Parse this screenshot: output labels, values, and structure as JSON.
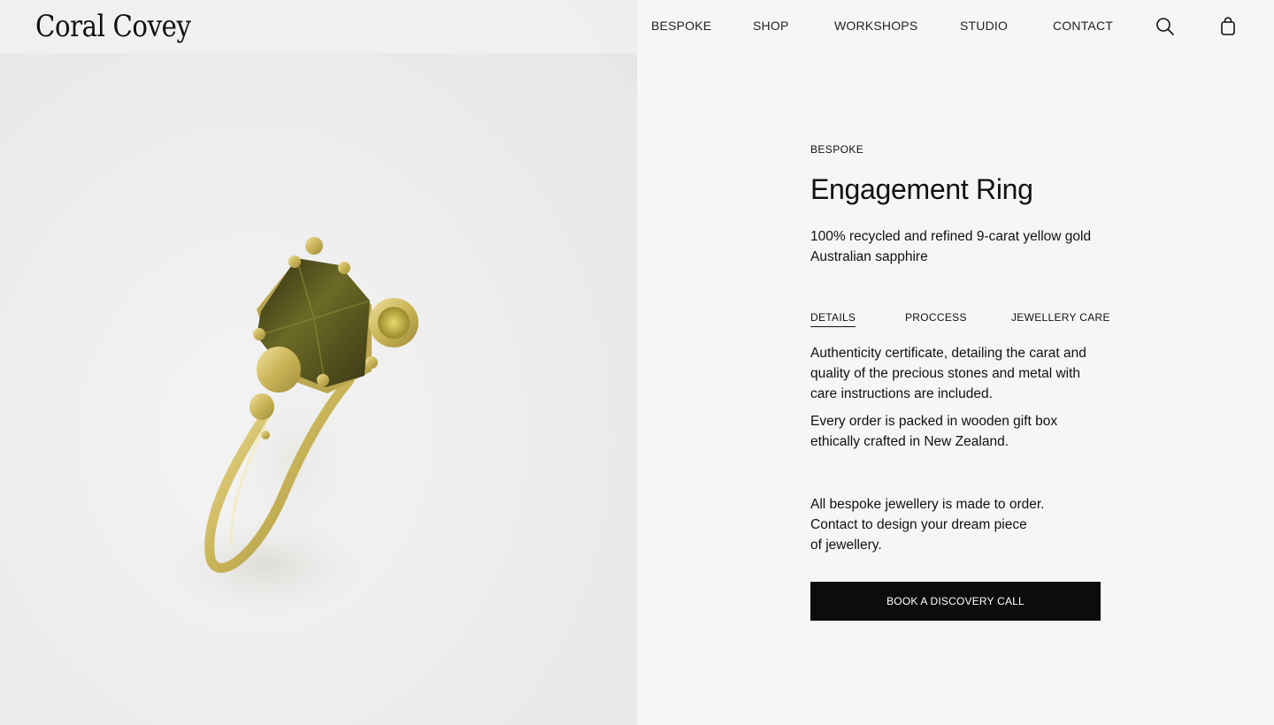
{
  "brand": {
    "logo_text": "Coral Covey"
  },
  "nav": {
    "items": [
      {
        "label": "BESPOKE"
      },
      {
        "label": "SHOP"
      },
      {
        "label": "WORKSHOPS"
      },
      {
        "label": "STUDIO"
      },
      {
        "label": "CONTACT"
      }
    ],
    "search_icon": "search-icon",
    "cart_icon": "shopping-bag-icon"
  },
  "hero": {
    "image_subject": "gold ring with green sapphire"
  },
  "product": {
    "category": "BESPOKE",
    "title": "Engagement Ring",
    "materials": [
      "100% recycled and refined 9-carat yellow gold",
      "Australian sapphire"
    ],
    "tabs": [
      {
        "label": "DETAILS",
        "active": true
      },
      {
        "label": "PROCCESS",
        "active": false
      },
      {
        "label": "JEWELLERY CARE",
        "active": false
      }
    ],
    "details": [
      "Authenticity certificate, detailing the carat and quality of the precious stones and metal with care instructions are included.",
      "Every order is packed in wooden gift box ethically crafted in New Zealand."
    ],
    "bespoke_note": [
      "All bespoke jewellery is made to order.",
      "Contact to design your dream piece",
      "of jewellery."
    ],
    "cta_label": "BOOK A DISCOVERY CALL"
  },
  "colors": {
    "background": "#f6f6f6",
    "button": "#0c0c0c",
    "gold": "#c9b560",
    "sapphire": "#5a5a1e"
  }
}
